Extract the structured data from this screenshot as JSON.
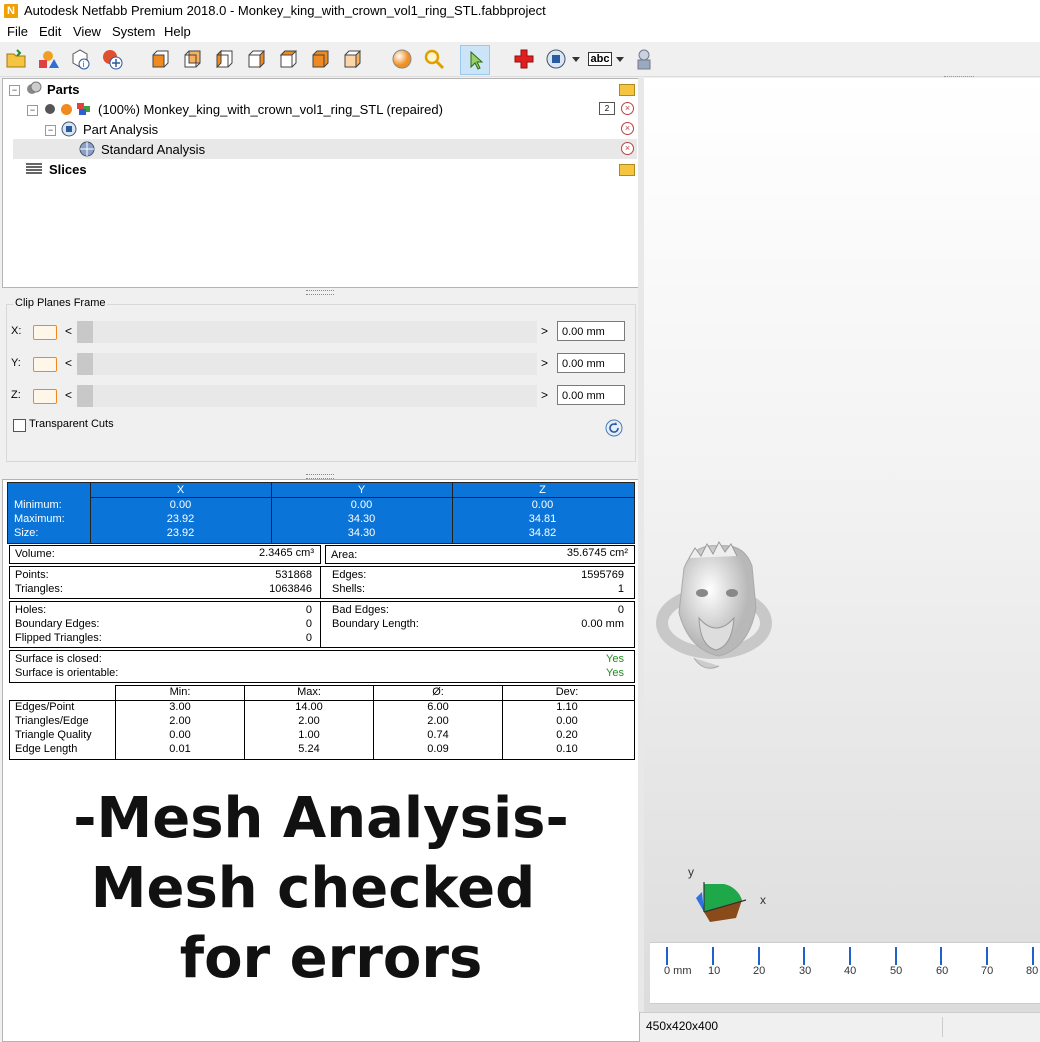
{
  "window": {
    "app_icon_glyph": "N",
    "title": "Autodesk Netfabb Premium 2018.0 - Monkey_king_with_crown_vol1_ring_STL.fabbproject"
  },
  "menu": [
    "File",
    "Edit",
    "View",
    "System",
    "Help"
  ],
  "toolbar": {
    "icons": [
      "open-folder-icon",
      "shapes-icon",
      "cube-info-icon",
      "add-part-icon",
      "view-front-icon",
      "view-back-icon",
      "view-left-icon",
      "view-right-icon",
      "view-top-icon",
      "view-bottom-icon",
      "view-iso-icon",
      "sphere-render-icon",
      "zoom-icon",
      "select-pointer-icon",
      "red-cross-icon",
      "measure-dropdown-icon",
      "label-abc-icon",
      "settings-person-icon"
    ],
    "abc_label": "abc"
  },
  "tree": {
    "parts_label": "Parts",
    "part_name": "(100%) Monkey_king_with_crown_vol1_ring_STL (repaired)",
    "part_badge": "2",
    "part_analysis_label": "Part Analysis",
    "standard_analysis_label": "Standard Analysis",
    "slices_label": "Slices"
  },
  "clip": {
    "title": "Clip Planes Frame",
    "rows": [
      {
        "axis": "X:",
        "value": "0.00 mm"
      },
      {
        "axis": "Y:",
        "value": "0.00 mm"
      },
      {
        "axis": "Z:",
        "value": "0.00 mm"
      }
    ],
    "arrow_left": "<",
    "arrow_right": ">",
    "transparent_label": "Transparent Cuts"
  },
  "bbox": {
    "headers": [
      "X",
      "Y",
      "Z"
    ],
    "rows": [
      {
        "label": "Minimum:",
        "values": [
          "0.00",
          "0.00",
          "0.00"
        ]
      },
      {
        "label": "Maximum:",
        "values": [
          "23.92",
          "34.30",
          "34.81"
        ]
      },
      {
        "label": "Size:",
        "values": [
          "23.92",
          "34.30",
          "34.82"
        ]
      }
    ]
  },
  "stats": {
    "volume_label": "Volume:",
    "volume_value": "2.3465 cm³",
    "area_label": "Area:",
    "area_value": "35.6745 cm²",
    "points_label": "Points:",
    "points_value": "531868",
    "triangles_label": "Triangles:",
    "triangles_value": "1063846",
    "edges_label": "Edges:",
    "edges_value": "1595769",
    "shells_label": "Shells:",
    "shells_value": "1",
    "holes_label": "Holes:",
    "holes_value": "0",
    "boundary_edges_label": "Boundary Edges:",
    "boundary_edges_value": "0",
    "flipped_label": "Flipped Triangles:",
    "flipped_value": "0",
    "bad_edges_label": "Bad Edges:",
    "bad_edges_value": "0",
    "boundary_length_label": "Boundary Length:",
    "boundary_length_value": "0.00 mm",
    "closed_label": "Surface is closed:",
    "closed_value": "Yes",
    "orientable_label": "Surface is orientable:",
    "orientable_value": "Yes"
  },
  "quality": {
    "headers": [
      "Min:",
      "Max:",
      "Ø:",
      "Dev:"
    ],
    "rows": [
      {
        "label": "Edges/Point",
        "values": [
          "3.00",
          "14.00",
          "6.00",
          "1.10"
        ]
      },
      {
        "label": "Triangles/Edge",
        "values": [
          "2.00",
          "2.00",
          "2.00",
          "0.00"
        ]
      },
      {
        "label": "Triangle Quality",
        "values": [
          "0.00",
          "1.00",
          "0.74",
          "0.20"
        ]
      },
      {
        "label": "Edge Length",
        "values": [
          "0.01",
          "5.24",
          "0.09",
          "0.10"
        ]
      }
    ]
  },
  "overlay": {
    "line1": "-Mesh Analysis-",
    "line2": "Mesh checked",
    "line3": "for errors"
  },
  "viewport": {
    "axis_y": "y",
    "axis_x": "x",
    "ruler": [
      "0 mm",
      "10",
      "20",
      "30",
      "40",
      "50",
      "60",
      "70",
      "80"
    ],
    "status": "450x420x400"
  }
}
